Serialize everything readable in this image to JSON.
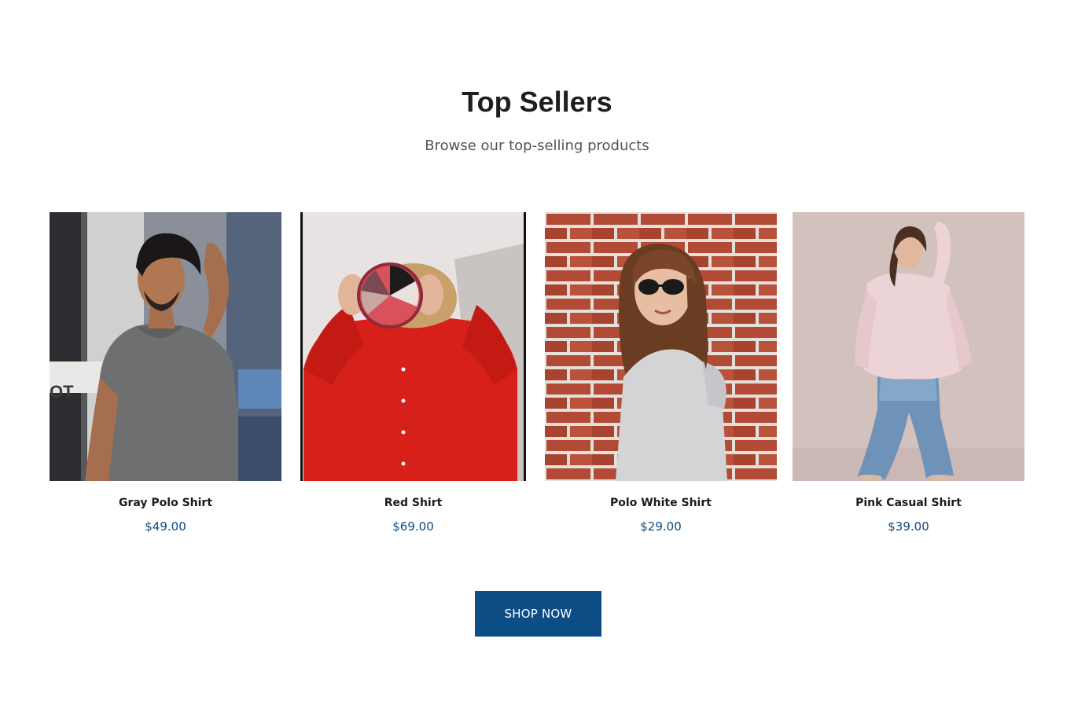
{
  "header": {
    "title": "Top Sellers",
    "subtitle": "Browse our top-selling products"
  },
  "products": [
    {
      "name": "Gray Polo Shirt",
      "price": "$49.00"
    },
    {
      "name": "Red Shirt",
      "price": "$69.00"
    },
    {
      "name": "Polo White Shirt",
      "price": "$29.00"
    },
    {
      "name": "Pink Casual Shirt",
      "price": "$39.00"
    }
  ],
  "cta": {
    "label": "SHOP NOW"
  },
  "colors": {
    "accent": "#0c4d85",
    "price": "#0e4a80",
    "title": "#1e1e1e",
    "subtitle": "#555555"
  }
}
